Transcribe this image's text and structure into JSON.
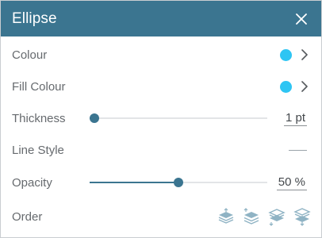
{
  "header": {
    "title": "Ellipse",
    "close_icon": "close-icon"
  },
  "colour": {
    "label": "Colour",
    "value_color": "#2ec5f3"
  },
  "fill_colour": {
    "label": "Fill Colour",
    "value_color": "#2ec5f3"
  },
  "thickness": {
    "label": "Thickness",
    "value": "1 pt",
    "slider_fraction": 0.0
  },
  "line_style": {
    "label": "Line Style",
    "style": "solid"
  },
  "opacity": {
    "label": "Opacity",
    "value": "50 %",
    "slider_fraction": 0.5
  },
  "order": {
    "label": "Order",
    "icons": [
      "bring-to-front-icon",
      "bring-forward-icon",
      "send-backward-icon",
      "send-to-back-icon"
    ]
  },
  "colors": {
    "accent": "#3b7590",
    "swatch": "#2ec5f3",
    "label_text": "#666a6e"
  }
}
